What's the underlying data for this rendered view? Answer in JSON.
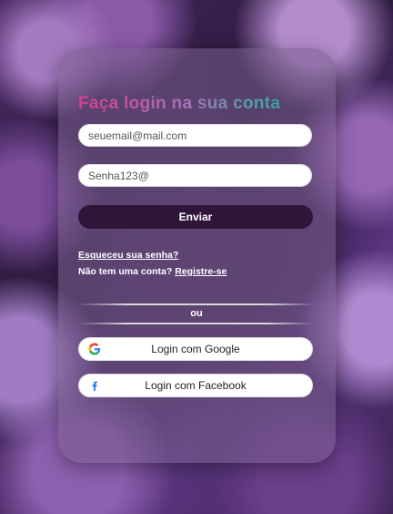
{
  "login": {
    "title": "Faça login na sua conta",
    "email_placeholder": "seuemail@mail.com",
    "password_placeholder": "Senha123@",
    "submit_label": "Enviar",
    "forgot_label": "Esqueceu sua senha?",
    "no_account_text": "Não tem uma conta? ",
    "register_label": "Registre-se",
    "separator_text": "ou",
    "google_label": "Login com Google",
    "facebook_label": "Login com Facebook"
  },
  "colors": {
    "submit_bg": "#2f1537",
    "google_blue": "#4285F4",
    "google_red": "#EA4335",
    "google_yellow": "#FBBC05",
    "google_green": "#34A853",
    "facebook_blue": "#1877F2"
  }
}
